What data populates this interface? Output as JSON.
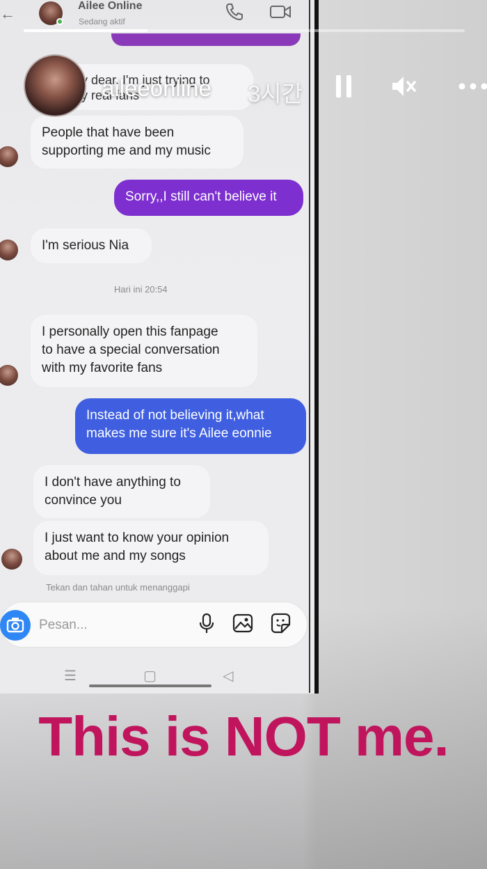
{
  "story": {
    "username": "aileeonline",
    "time_ago": "3시간",
    "progress": 0.28,
    "headline": "This is NOT me."
  },
  "messenger": {
    "contact_name": "Ailee Online",
    "contact_status": "Sedang aktif",
    "composer_placeholder": "Pesan...",
    "hint": "Tekan dan tahan untuk menanggapi",
    "timestamp": "Hari ini 20:54",
    "messages": [
      {
        "dir": "in",
        "text_l1": "my dear, I'm just trying to",
        "text_l2": "my real fans"
      },
      {
        "dir": "in",
        "text_l1": "People that have been",
        "text_l2": "supporting me and my music"
      },
      {
        "dir": "out",
        "text_l1": "Sorry,,I still can't believe it"
      },
      {
        "dir": "in",
        "text_l1": "I'm serious Nia"
      },
      {
        "dir": "in",
        "text_l1": "I personally open this fanpage",
        "text_l2": "to have a special conversation",
        "text_l3": "with my favorite fans"
      },
      {
        "dir": "out",
        "text_l1": "Instead of not believing it,what",
        "text_l2": "makes me sure it's Ailee eonnie"
      },
      {
        "dir": "in",
        "text_l1": "I don't have anything to",
        "text_l2": "convince you"
      },
      {
        "dir": "in",
        "text_l1": "I just want to know your opinion",
        "text_l2": "about me and my songs"
      }
    ]
  },
  "colors": {
    "headline": "#c0155d",
    "purple_bubble": "#7d2fd0",
    "blue_bubble": "#3f5fe0",
    "camera_button": "#2f86f5"
  }
}
